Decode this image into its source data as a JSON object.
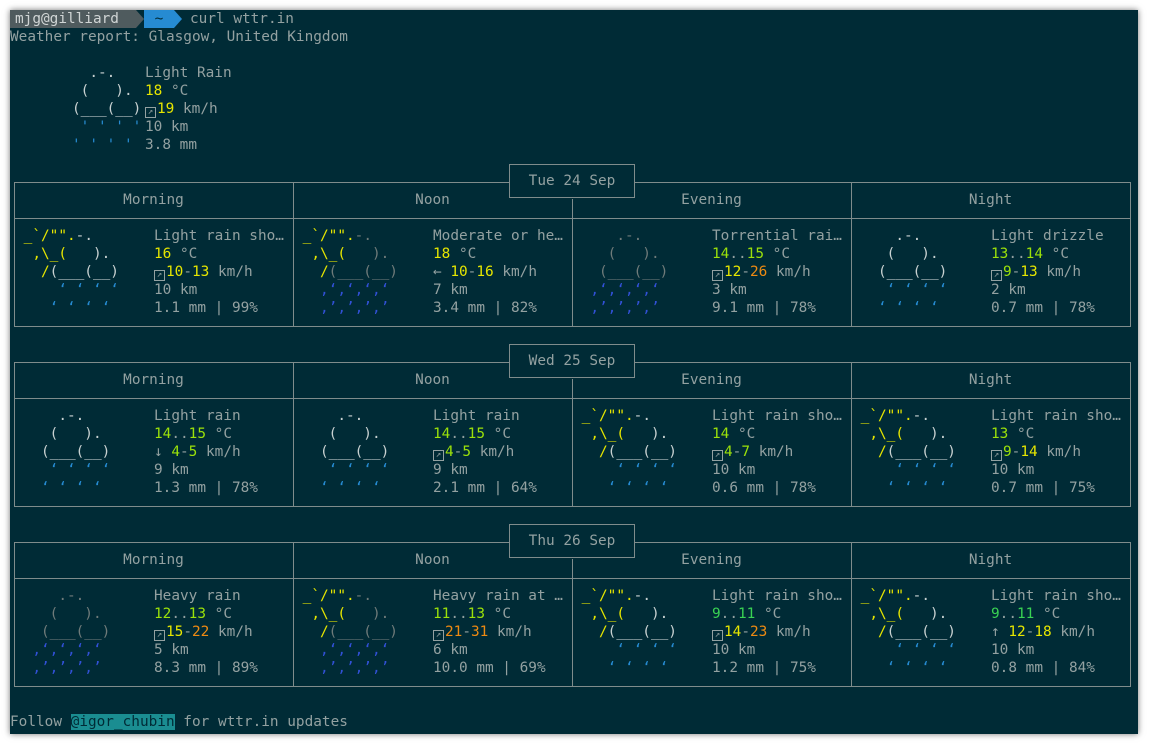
{
  "prompt": {
    "user": "mjg@gilliard",
    "dir": "~",
    "command": "curl wttr.in"
  },
  "report_title": "Weather report: Glasgow, United Kingdom",
  "current": {
    "condition": "Light Rain",
    "temp": "18",
    "temp_unit": "°C",
    "wind": "19",
    "wind_unit": "km/h",
    "visibility": "10 km",
    "precip": "3.8 mm"
  },
  "days": [
    {
      "date": "Tue 24 Sep",
      "periods": [
        {
          "name": "Morning",
          "art": "sunny-showers",
          "desc": "Light rain sho…",
          "t1": "16",
          "t2": "",
          "wdir": "box",
          "w1": "10",
          "w2": "13",
          "vis": "10 km",
          "precip": "1.1 mm | 99%"
        },
        {
          "name": "Noon",
          "art": "sunny-heavy",
          "desc": "Moderate or he…",
          "t1": "18",
          "t2": "",
          "wdir": "←",
          "w1": "10",
          "w2": "16",
          "vis": "7 km",
          "precip": "3.4 mm | 82%"
        },
        {
          "name": "Evening",
          "art": "heavy",
          "desc": "Torrential rai…",
          "t1": "14",
          "t2": "15",
          "wdir": "box",
          "w1": "12",
          "w2": "26",
          "vis": "3 km",
          "precip": "9.1 mm | 78%"
        },
        {
          "name": "Night",
          "art": "light",
          "desc": "Light drizzle",
          "t1": "13",
          "t2": "14",
          "wdir": "box",
          "w1": "9",
          "w2": "13",
          "vis": "2 km",
          "precip": "0.7 mm | 78%"
        }
      ]
    },
    {
      "date": "Wed 25 Sep",
      "periods": [
        {
          "name": "Morning",
          "art": "light",
          "desc": "Light rain",
          "t1": "14",
          "t2": "15",
          "wdir": "↓",
          "w1": "4",
          "w2": "5",
          "vis": "9 km",
          "precip": "1.3 mm | 78%"
        },
        {
          "name": "Noon",
          "art": "light",
          "desc": "Light rain",
          "t1": "14",
          "t2": "15",
          "wdir": "box",
          "w1": "4",
          "w2": "5",
          "vis": "9 km",
          "precip": "2.1 mm | 64%"
        },
        {
          "name": "Evening",
          "art": "sunny-showers",
          "desc": "Light rain sho…",
          "t1": "14",
          "t2": "",
          "wdir": "box",
          "w1": "4",
          "w2": "7",
          "vis": "10 km",
          "precip": "0.6 mm | 78%"
        },
        {
          "name": "Night",
          "art": "sunny-showers",
          "desc": "Light rain sho…",
          "t1": "13",
          "t2": "",
          "wdir": "box",
          "w1": "9",
          "w2": "14",
          "vis": "10 km",
          "precip": "0.7 mm | 75%"
        }
      ]
    },
    {
      "date": "Thu 26 Sep",
      "periods": [
        {
          "name": "Morning",
          "art": "heavy",
          "desc": "Heavy rain",
          "t1": "12",
          "t2": "13",
          "wdir": "box",
          "w1": "15",
          "w2": "22",
          "vis": "5 km",
          "precip": "8.3 mm | 89%"
        },
        {
          "name": "Noon",
          "art": "sunny-heavy",
          "desc": "Heavy rain at …",
          "t1": "11",
          "t2": "13",
          "wdir": "box",
          "w1": "21",
          "w2": "31",
          "vis": "6 km",
          "precip": "10.0 mm | 69%"
        },
        {
          "name": "Evening",
          "art": "sunny-showers",
          "desc": "Light rain sho…",
          "t1": "9",
          "t2": "11",
          "wdir": "box",
          "w1": "14",
          "w2": "23",
          "vis": "10 km",
          "precip": "1.2 mm | 75%"
        },
        {
          "name": "Night",
          "art": "sunny-showers",
          "desc": "Light rain sho…",
          "t1": "9",
          "t2": "11",
          "wdir": "↑",
          "w1": "12",
          "w2": "18",
          "vis": "10 km",
          "precip": "0.8 mm | 84%"
        }
      ]
    }
  ],
  "footer": {
    "pre": "Follow ",
    "handle": "@igor_chubin",
    "post": " for wttr.in updates"
  },
  "colors": {
    "background": "#002b36",
    "text": "#93a1a1",
    "temp_cool": "#9be10a",
    "temp_warm": "#e6e600",
    "wind_high": "#ee8a12",
    "rain": "#268bd2",
    "heavy_rain": "#3251d8"
  }
}
